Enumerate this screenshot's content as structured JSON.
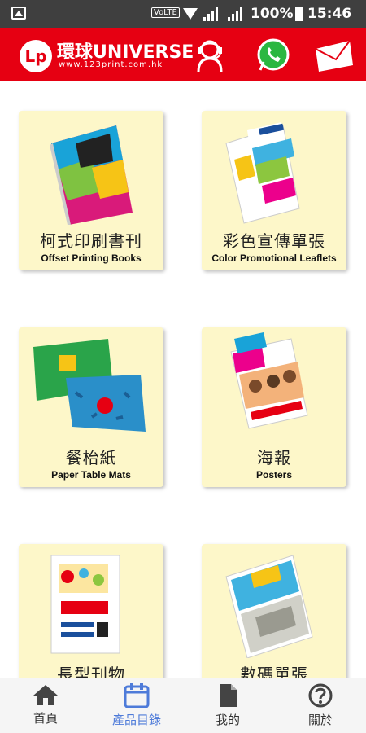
{
  "status_bar": {
    "network": "VoLTE",
    "battery": "100%",
    "time": "15:46"
  },
  "header": {
    "logo_text": "Lp",
    "brand": "環球UNIVERSE",
    "url": "www.123print.com.hk",
    "icons": [
      "customer-service-icon",
      "whatsapp-icon",
      "mail-icon"
    ],
    "brand_color": "#e60012"
  },
  "products": [
    {
      "cn": "柯式印刷書刊",
      "en": "Offset Printing Books"
    },
    {
      "cn": "彩色宣傳單張",
      "en": "Color Promotional Leaflets"
    },
    {
      "cn": "餐枱紙",
      "en": "Paper Table Mats"
    },
    {
      "cn": "海報",
      "en": "Posters"
    },
    {
      "cn": "長型刊物",
      "en": ""
    },
    {
      "cn": "數碼單張",
      "en": ""
    }
  ],
  "nav": {
    "items": [
      {
        "label": "首頁",
        "icon": "home-icon"
      },
      {
        "label": "產品目錄",
        "icon": "calendar-icon"
      },
      {
        "label": "我的",
        "icon": "document-icon"
      },
      {
        "label": "關於",
        "icon": "help-icon"
      }
    ],
    "active_index": 1,
    "active_color": "#4e7bd9"
  }
}
